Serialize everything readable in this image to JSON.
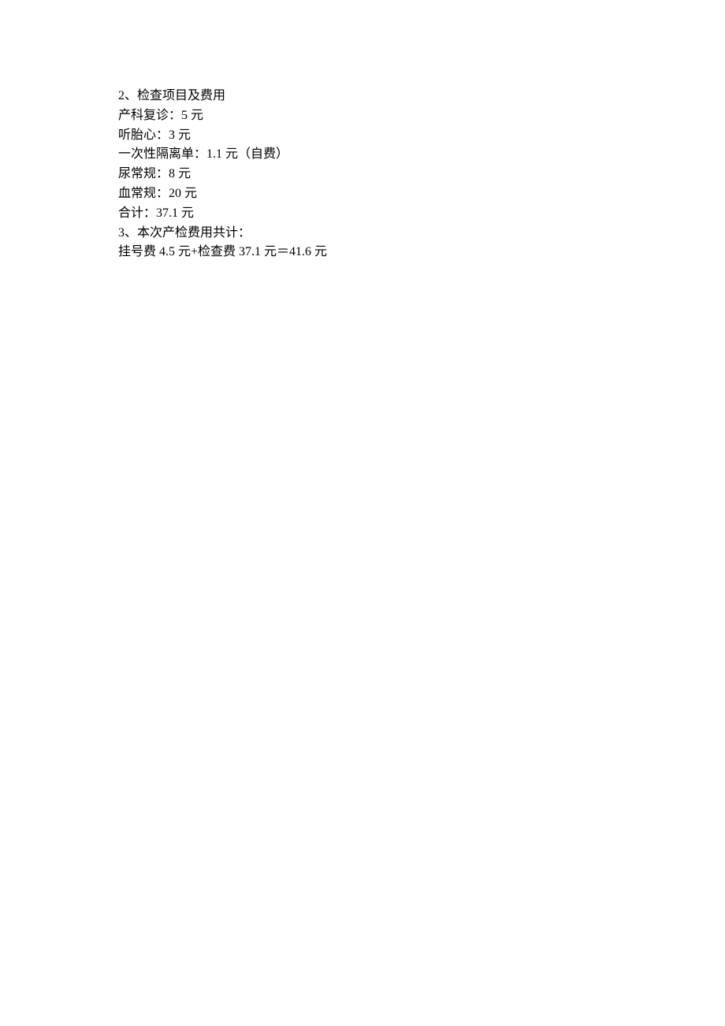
{
  "lines": [
    "2、检查项目及费用",
    "产科复诊：5 元",
    "听胎心：3 元",
    "一次性隔离单：1.1 元（自费）",
    "尿常规：8 元",
    "血常规：20 元",
    "合计：37.1 元",
    "3、本次产检费用共计：",
    "挂号费 4.5 元+检查费 37.1 元＝41.6 元"
  ]
}
